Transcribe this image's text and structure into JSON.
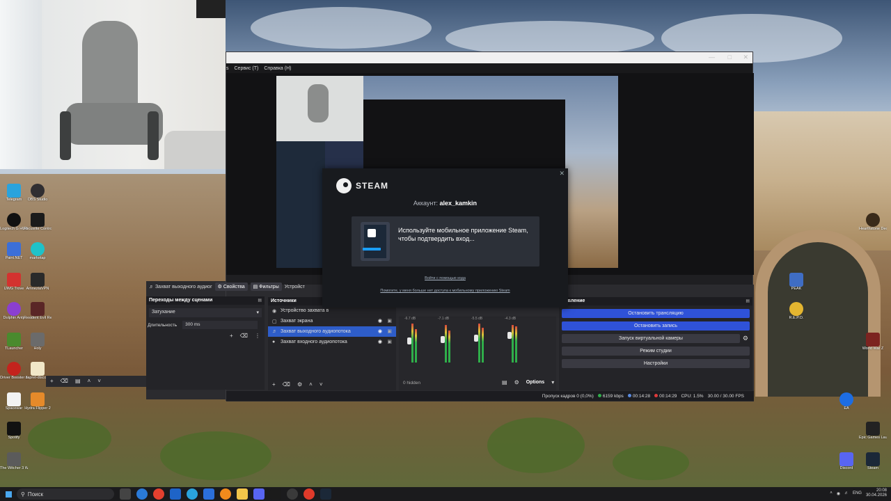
{
  "obs": {
    "menu": [
      "s",
      "Сервис (Т)",
      "Справка (H)"
    ],
    "context_bar": {
      "source": "Захват выходного аудиог",
      "properties": "Свойства",
      "filters": "Фильтры",
      "settings": "Устройст"
    },
    "transitions": {
      "title": "Переходы между сценами",
      "type": "Затухание",
      "duration_label": "Длительность",
      "duration_value": "300 ms"
    },
    "sources": {
      "title": "Источники",
      "items": [
        {
          "label": "Устройство захвата в",
          "selected": false,
          "icon": "camera-icon"
        },
        {
          "label": "Захват экрана",
          "selected": false,
          "icon": "monitor-icon"
        },
        {
          "label": "Захват выходного аудиопотока",
          "selected": true,
          "icon": "speaker-icon"
        },
        {
          "label": "Захват входного аудиопотока",
          "selected": false,
          "icon": "mic-icon"
        }
      ]
    },
    "mixer": {
      "db_labels": [
        "-6.7 dB",
        "-7.1 dB",
        "-5.5 dB",
        "-4.3 dB"
      ],
      "hidden_label": "0 hidden",
      "options_label": "Options"
    },
    "controls": {
      "title": "лявление",
      "buttons": [
        {
          "label": "Остановить трансляцию",
          "active": true
        },
        {
          "label": "Остановить запись",
          "active": true
        },
        {
          "label": "Запуск виртуальной камеры",
          "active": false
        },
        {
          "label": "Режим студии",
          "active": false
        },
        {
          "label": "Настройки",
          "active": false
        }
      ]
    },
    "status": {
      "dropped": "Пропуск кадров 0 (0,0%)",
      "bitrate": "6159 kbps",
      "stream_time": "00:14:28",
      "rec_time": "00:14:29",
      "cpu": "CPU: 1.5%",
      "fps": "30.00 / 30.00 FPS"
    }
  },
  "steam": {
    "logo_text": "STEAM",
    "account_prefix": "Аккаунт:",
    "account_name": "alex_kamkin",
    "message": "Используйте мобильное приложение Steam, чтобы подтвердить вход...",
    "link_code": "Войти с помощью кода",
    "link_help": "Помогите, у меня больше нет доступа к мобильному приложению Steam"
  },
  "desktop_icons": {
    "left": [
      "Telegram",
      "OBS Studio",
      "Logitech G HUB",
      "Focusrite Control",
      "Paint.NET",
      "marketap",
      "UWG Trove",
      "AmneziaVPN",
      "Dolphin Anty",
      "Resident Evil Requiem",
      "TLauncher",
      "Holy",
      "Driver Booster 6",
      "zapret-discord",
      "Spacewar",
      "Hydra Flipper 2",
      "Spotify",
      "The Witcher 3 Wild Hu..."
    ],
    "right": [
      "PEAK",
      "R.E.P.O.",
      "EA",
      "Steam",
      "Discord",
      "Epic Games Launcher",
      "World War Z",
      "Hearthstone Deck Tracker"
    ]
  },
  "taskbar": {
    "search_placeholder": "Поиск",
    "lang": "ENG",
    "time": "20:08",
    "date": "30.04.2026"
  }
}
